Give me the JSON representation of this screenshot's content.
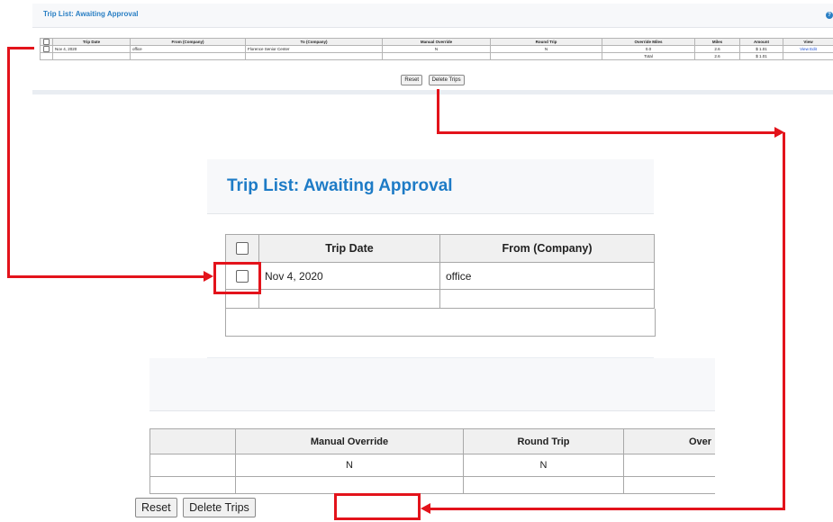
{
  "window": {
    "title": "Trip List: Awaiting Approval"
  },
  "table": {
    "columns": [
      "Trip Date",
      "From (Company)",
      "To (Company)",
      "Manual Override",
      "Round Trip",
      "Override Miles",
      "Miles",
      "Amount",
      "View"
    ],
    "row": {
      "trip_date": "Nov 4, 2020",
      "from": "office",
      "to": "Florence Senior Center",
      "manual_override": "N",
      "round_trip": "N",
      "override_miles": "0.0",
      "miles": "2.6",
      "amount": "$ 1.01",
      "view_link": "View",
      "edit_link": "Edit"
    },
    "total": {
      "label": "Total",
      "miles": "2.6",
      "amount": "$ 1.01"
    }
  },
  "buttons": {
    "reset": "Reset",
    "delete": "Delete Trips"
  },
  "zoom2": {
    "partial_header": "Over"
  },
  "colors": {
    "accent": "#1d7bc6",
    "highlight": "#e3131b"
  },
  "icons": {
    "help": "help-circle-icon"
  }
}
